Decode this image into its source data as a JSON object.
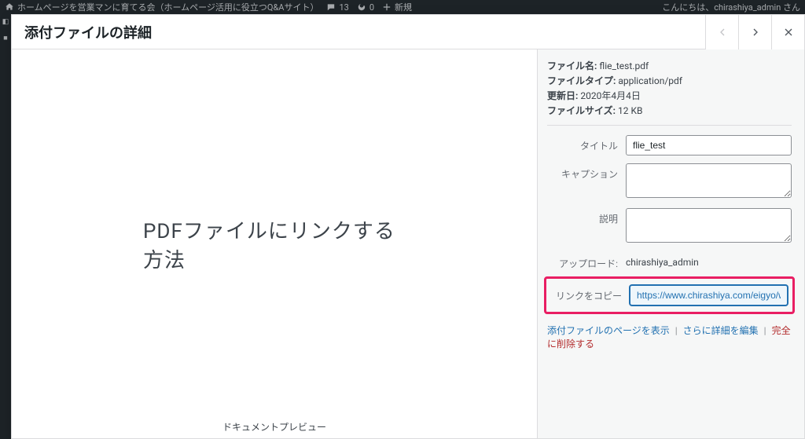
{
  "adminbar": {
    "site_title": "ホームページを営業マンに育てる会（ホームページ活用に役立つQ&Aサイト）",
    "comments_count": "13",
    "updates_count": "0",
    "new_label": "新規",
    "greeting": "こんにちは、chirashiya_admin さん"
  },
  "modal": {
    "title": "添付ファイルの詳細"
  },
  "meta": {
    "filename_label": "ファイル名:",
    "filename": "flie_test.pdf",
    "filetype_label": "ファイルタイプ:",
    "filetype": "application/pdf",
    "updated_label": "更新日:",
    "updated": "2020年4月4日",
    "filesize_label": "ファイルサイズ:",
    "filesize": "12 KB"
  },
  "fields": {
    "title_label": "タイトル",
    "title_value": "flie_test",
    "caption_label": "キャプション",
    "caption_value": "",
    "description_label": "説明",
    "description_value": "",
    "upload_label": "アップロード:",
    "upload_value": "chirashiya_admin",
    "copylink_label": "リンクをコピー",
    "copylink_value": "https://www.chirashiya.com/eigyo/wp-"
  },
  "actions": {
    "view": "添付ファイルのページを表示",
    "edit_more": "さらに詳細を編集",
    "delete": "完全に削除する"
  },
  "preview": {
    "headline": "PDFファイルにリンクする方法",
    "caption": "ドキュメントプレビュー"
  }
}
